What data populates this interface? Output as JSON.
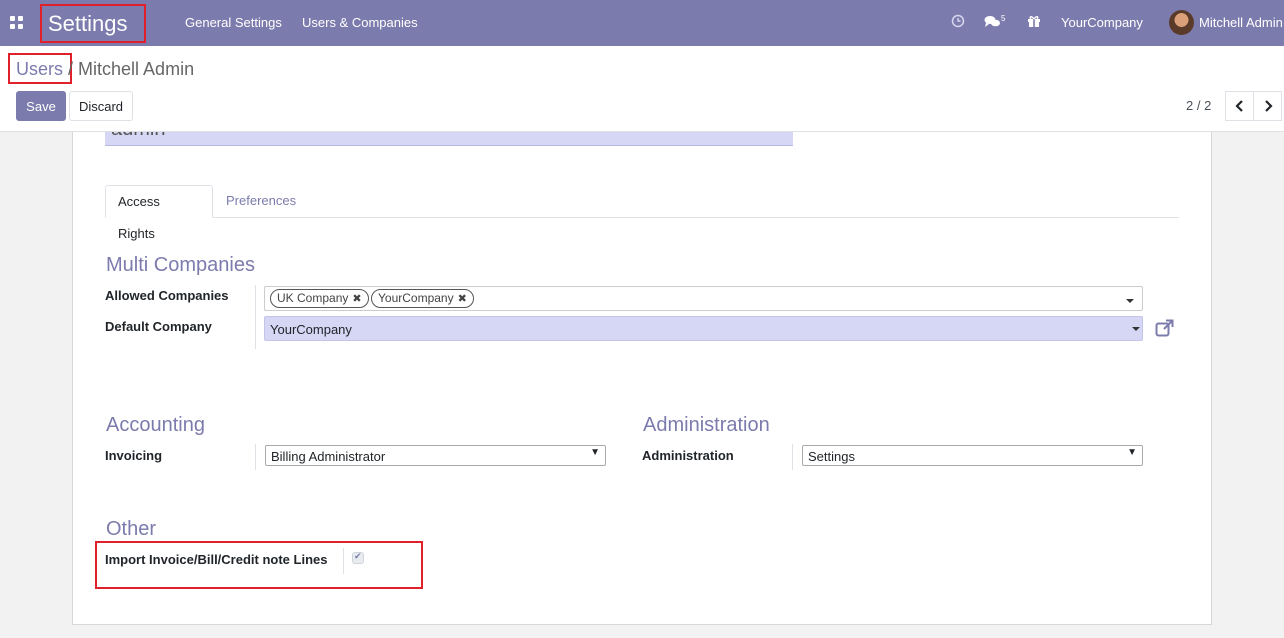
{
  "navbar": {
    "app_title": "Settings",
    "menu": [
      "General Settings",
      "Users & Companies"
    ],
    "activity_icon": "clock-icon",
    "messages_icon": "chat-icon",
    "messages_count": "5",
    "gift_icon": "gift-icon",
    "company": "YourCompany",
    "user": "Mitchell Admin"
  },
  "breadcrumb": {
    "parent": "Users",
    "separator": "/",
    "current": "Mitchell Admin"
  },
  "buttons": {
    "save": "Save",
    "discard": "Discard"
  },
  "pager": {
    "value": "2 / 2",
    "prev_icon": "chevron-left-icon",
    "next_icon": "chevron-right-icon"
  },
  "form": {
    "login": "admin",
    "tabs": [
      {
        "label": "Access Rights",
        "active": true
      },
      {
        "label": "Preferences",
        "active": false
      }
    ],
    "multi_companies": {
      "title": "Multi Companies",
      "allowed_label": "Allowed Companies",
      "allowed_tags": [
        "UK Company",
        "YourCompany"
      ],
      "default_label": "Default Company",
      "default_value": "YourCompany"
    },
    "accounting": {
      "title": "Accounting",
      "invoicing_label": "Invoicing",
      "invoicing_value": "Billing Administrator"
    },
    "administration": {
      "title": "Administration",
      "label": "Administration",
      "value": "Settings"
    },
    "other": {
      "title": "Other",
      "import_label": "Import Invoice/Bill/Credit note Lines",
      "import_checked": true
    }
  },
  "colors": {
    "primary": "#7c7bad",
    "highlight": "#e0202a",
    "field_bg": "#d6d6f5"
  }
}
